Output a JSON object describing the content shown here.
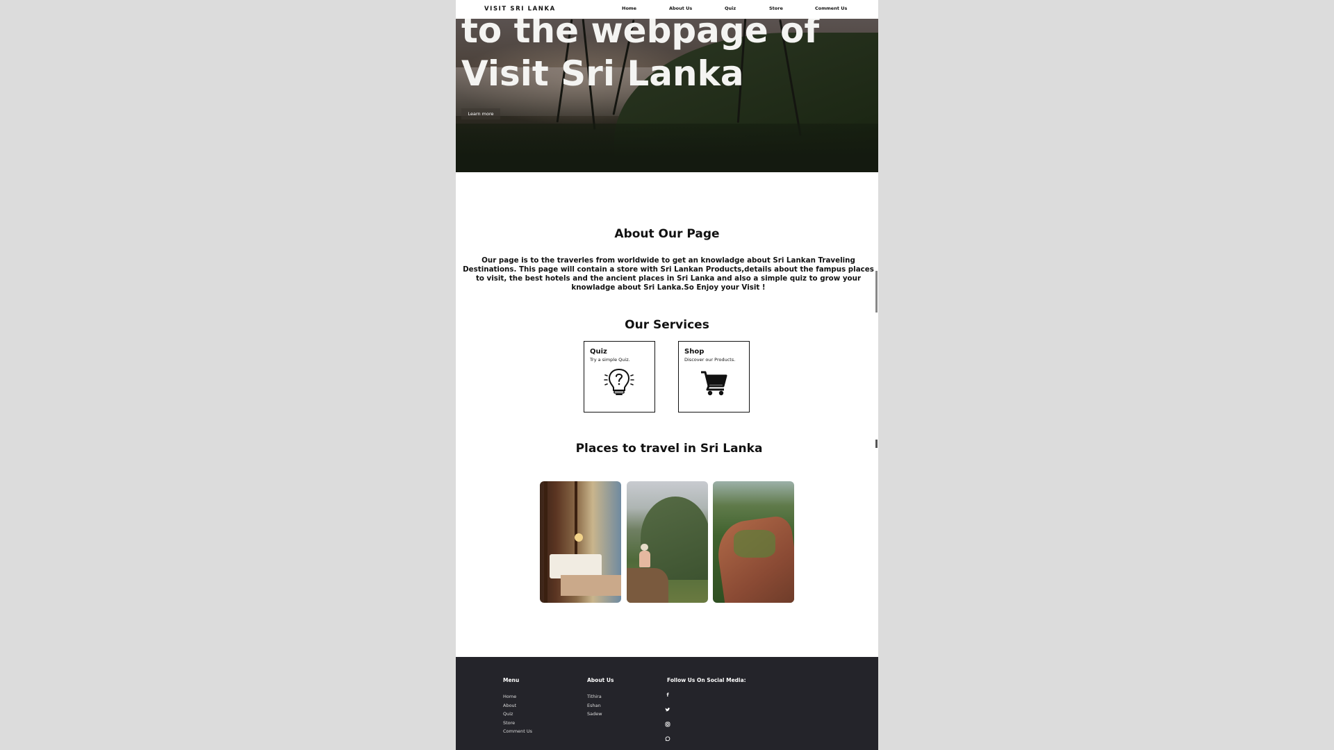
{
  "nav": {
    "brand": "VISIT SRI LANKA",
    "links": [
      "Home",
      "About Us",
      "Quiz",
      "Store",
      "Comment Us"
    ]
  },
  "hero": {
    "title_line1": "to the webpage of",
    "title_line2": "Visit Sri Lanka",
    "button_label": "Learn more"
  },
  "about": {
    "heading": "About Our Page",
    "text": "Our page is to the traverles from worldwide to get an knowladge about Sri Lankan Traveling Destinations. This page will contain a store with Sri Lankan Products,details about the fampus places to visit, the best hotels and the ancient places in Sri Lanka and also a simple quiz to grow your knowladge about Sri Lanka.So Enjoy your Visit !"
  },
  "services": {
    "heading": "Our Services",
    "cards": [
      {
        "title": "Quiz",
        "subtitle": "Try a simple Quiz.",
        "icon": "lightbulb-question-icon"
      },
      {
        "title": "Shop",
        "subtitle": "Discover our Products.",
        "icon": "shopping-cart-icon"
      }
    ]
  },
  "places": {
    "heading": "Places to travel in Sri Lanka",
    "photos": [
      "hotel-bedroom-photo",
      "mountain-hiker-photo",
      "sigiriya-rock-photo"
    ]
  },
  "footer": {
    "menu_heading": "Menu",
    "menu_links": [
      "Home",
      "About",
      "Quiz",
      "Store",
      "Comment Us"
    ],
    "about_heading": "About Us",
    "about_links": [
      "Tithira",
      "Eshan",
      "Sadew"
    ],
    "social_heading": "Follow Us On Social Media:",
    "social_icons": [
      "facebook-icon",
      "twitter-icon",
      "instagram-icon",
      "whatsapp-icon"
    ]
  },
  "colors": {
    "footer_bg": "#24242a",
    "page_bg": "#dcdcdc"
  }
}
